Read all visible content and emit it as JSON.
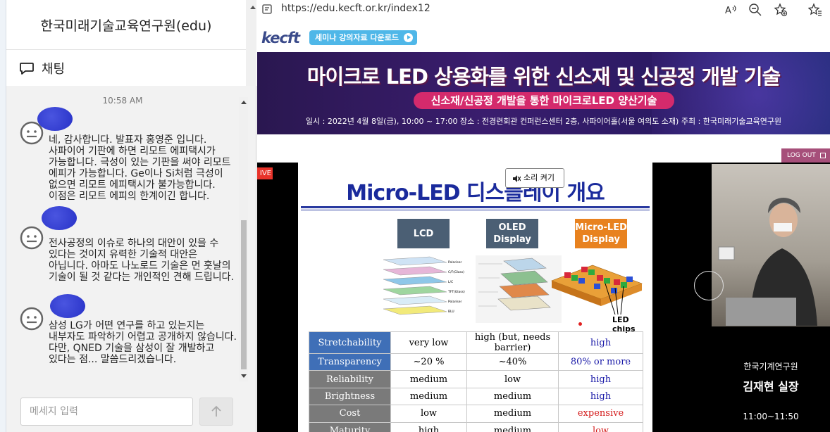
{
  "chat": {
    "title": "한국미래기술교육연구원(edu)",
    "tab_label": "채팅",
    "timestamp": "10:58 AM",
    "messages": [
      {
        "text": "네, 감사합니다. 발표자 홍영준 입니다. 사파이어 기판에 하면 리모트 에피택시가 가능합니다. 극성이 있는 기판을 써야 리모트 에피가 가능합니다. Ge이나 Si처럼 극성이 없으면 리모트 에피택시가 불가능합니다. 이점은 리모트 에피의 한계이긴 합니다."
      },
      {
        "text": "전사공정의 이슈로 하나의 대안이 있을 수 있다는 것이지 유력한 기술적 대안은 아닙니다. 아마도 나노로드 기술은 먼 훗날의 기술이 될 것 같다는 개인적인 견해 드립니다."
      },
      {
        "text": "삼성 LG가 어떤 연구를 하고 있는지는 내부자도 파악하기 어렵고 공개하지 않습니다. 다만, QNED 기술을 삼성이 잘 개발하고 있다는 점... 말씀드리겠습니다."
      }
    ],
    "input_placeholder": "메세지 입력"
  },
  "browser": {
    "url": "https://edu.kecft.or.kr/index12"
  },
  "site": {
    "logo": "kecft",
    "seminar_button": "세미나 강의자료 다운로드",
    "banner_title": "마이크로 LED 상용화를 위한 신소재 및 신공정 개발 기술",
    "banner_subtitle": "신소재/신공정 개발을 통한 마이크로LED 양산기술",
    "banner_info": "일시 : 2022년 4월 8일(금), 10:00 ~ 17:00   장소 : 전경련회관 컨퍼런스센터 2층, 사파이어홀(서울 여의도 소재)   주최 : 한국미래기술교육연구원",
    "logout": "LOG OUT",
    "live": "IVE"
  },
  "video": {
    "sound_button": "소리 켜기",
    "slide_title": "Micro-LED 디스플레이 개요",
    "columns": [
      "LCD",
      "OLED Display",
      "Micro-LED Display"
    ],
    "column_colors": [
      "#4b5f74",
      "#4b5f74",
      "#e8821f"
    ],
    "led_chips_label": "LED chips",
    "lcd_layers": [
      "Polariser",
      "C/F(Glass)",
      "L/C",
      "TFT(Glass)",
      "Polariser",
      "BLU"
    ],
    "table": [
      {
        "prop": "Stretchability",
        "lcd": "very low",
        "oled": "high (but, needs barrier)",
        "micro": "high",
        "micro_color": "#1a1aa8",
        "header": "blue"
      },
      {
        "prop": "Transparency",
        "lcd": "~20 %",
        "oled": "~40%",
        "micro": "80% or more",
        "micro_color": "#1a1aa8",
        "header": "blue"
      },
      {
        "prop": "Reliability",
        "lcd": "medium",
        "oled": "low",
        "micro": "high",
        "micro_color": "#1a1aa8",
        "header": "gray"
      },
      {
        "prop": "Brightness",
        "lcd": "medium",
        "oled": "medium",
        "micro": "high",
        "micro_color": "#1a1aa8",
        "header": "gray"
      },
      {
        "prop": "Cost",
        "lcd": "low",
        "oled": "medium",
        "micro": "expensive",
        "micro_color": "#d41a1a",
        "header": "gray"
      },
      {
        "prop": "Maturity",
        "lcd": "high",
        "oled": "medium",
        "micro": "low",
        "micro_color": "#d41a1a",
        "header": "gray"
      }
    ],
    "speaker_org": "한국기계연구원",
    "speaker_name": "김재현 실장",
    "speaker_time": "11:00~11:50"
  }
}
